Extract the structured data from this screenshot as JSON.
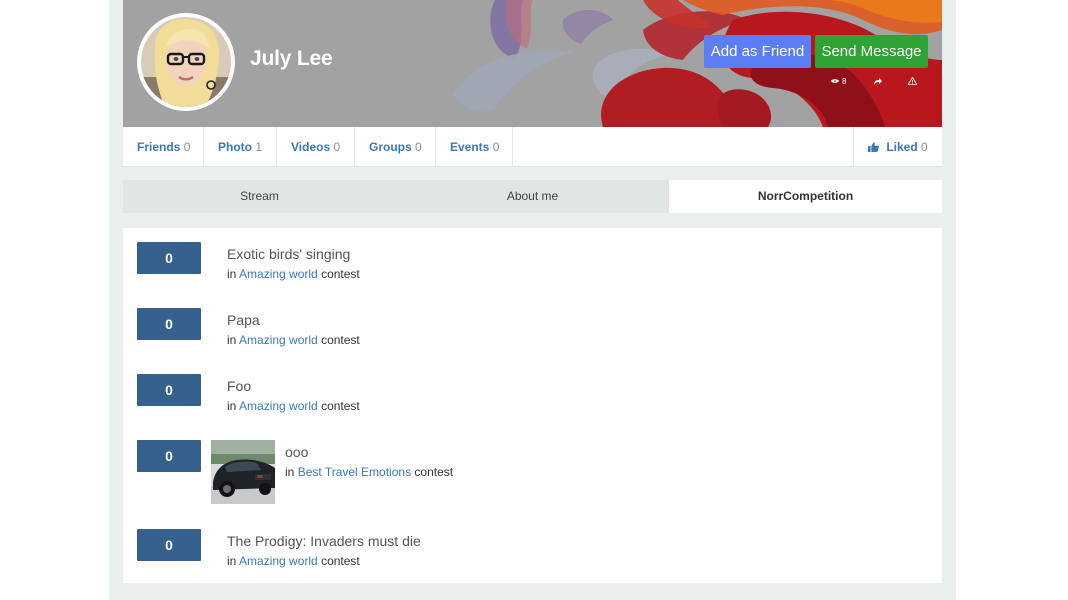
{
  "profile": {
    "name": "July Lee",
    "add_friend_label": "Add as Friend",
    "send_message_label": "Send Message",
    "views_count": "8",
    "share_icon": "share-icon",
    "report_icon": "warning-icon",
    "colors": {
      "add_friend": "#5b7ef7",
      "send_message": "#2ea233"
    }
  },
  "counts": {
    "friends": {
      "label": "Friends",
      "value": "0"
    },
    "photo": {
      "label": "Photo",
      "value": "1"
    },
    "videos": {
      "label": "Videos",
      "value": "0"
    },
    "groups": {
      "label": "Groups",
      "value": "0"
    },
    "events": {
      "label": "Events",
      "value": "0"
    },
    "liked": {
      "label": "Liked",
      "value": "0",
      "icon": "thumbs-up-icon"
    }
  },
  "tabs": [
    {
      "label": "Stream"
    },
    {
      "label": "About me"
    },
    {
      "label": "NorrCompetition",
      "active": true
    }
  ],
  "entries": [
    {
      "votes": "0",
      "title": "Exotic birds' singing",
      "in": "in",
      "contest": "Amazing world",
      "suffix": "contest"
    },
    {
      "votes": "0",
      "title": "Papa",
      "in": "in",
      "contest": "Amazing world",
      "suffix": "contest"
    },
    {
      "votes": "0",
      "title": "Foo",
      "in": "in",
      "contest": "Amazing world",
      "suffix": "contest"
    },
    {
      "votes": "0",
      "title": "ooo",
      "in": "in",
      "contest": "Best Travel Emotions",
      "suffix": "contest"
    },
    {
      "votes": "0",
      "title": "The Prodigy: Invaders must die",
      "in": "in",
      "contest": "Amazing world",
      "suffix": "contest"
    }
  ]
}
